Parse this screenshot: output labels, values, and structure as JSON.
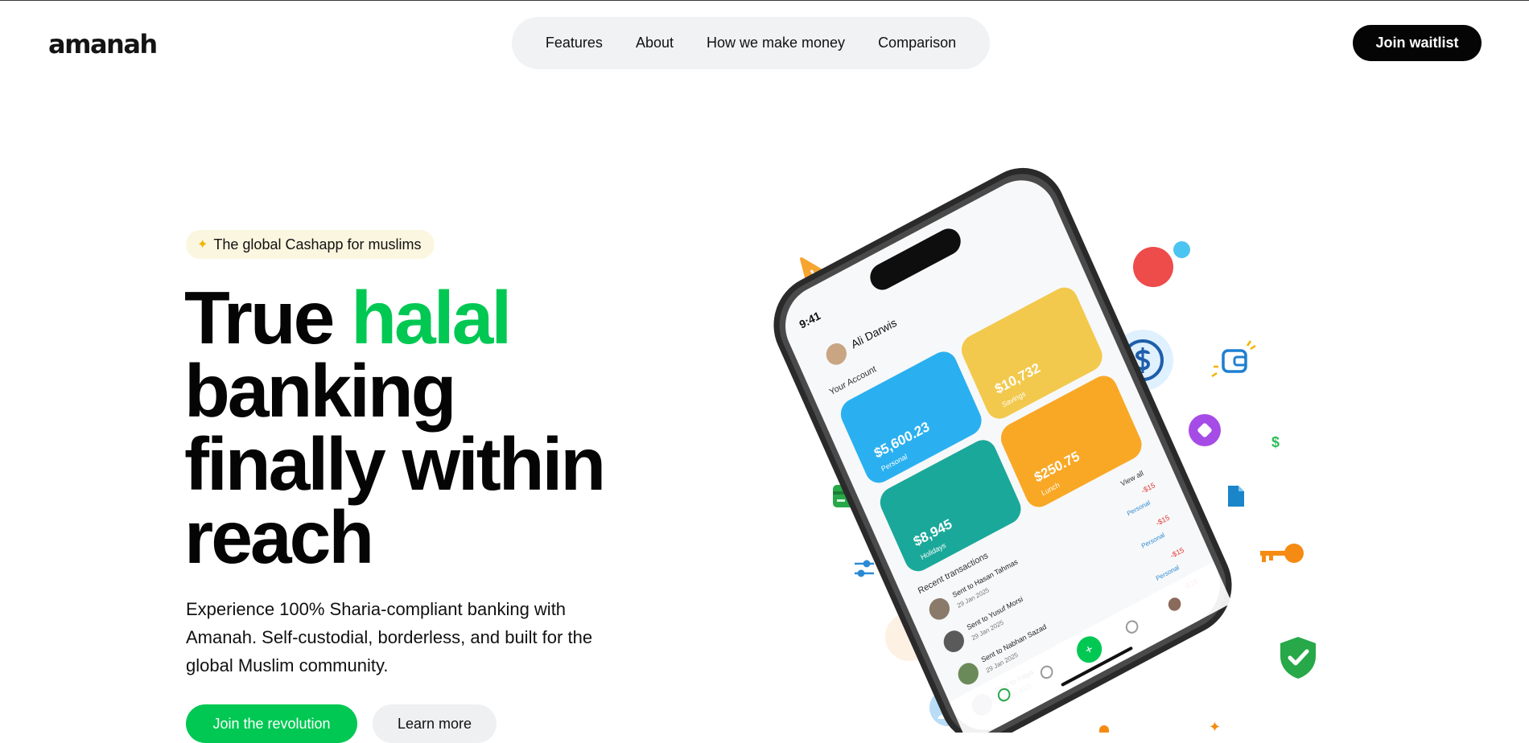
{
  "brand": {
    "logo_text": "amanah"
  },
  "nav": {
    "items": [
      {
        "label": "Features"
      },
      {
        "label": "About"
      },
      {
        "label": "How we make money"
      },
      {
        "label": "Comparison"
      }
    ]
  },
  "header": {
    "cta_label": "Join waitlist"
  },
  "hero": {
    "badge_text": "The global Cashapp for muslims",
    "badge_icon": "sparkle-icon",
    "title_part1": "True ",
    "title_highlight": "halal",
    "title_line2": "banking",
    "title_line3": "finally within",
    "title_line4": "reach",
    "description": "Experience 100% Sharia-compliant banking with Amanah. Self-custodial, borderless, and built for the global Muslim community.",
    "primary_cta": "Join the revolution",
    "secondary_cta": "Learn more"
  },
  "phone": {
    "time": "9:41",
    "user_name": "Ali Darwis",
    "section_title": "Your Account",
    "cards": [
      {
        "amount": "$5,600.23",
        "label": "Personal",
        "color": "#2ab0f0"
      },
      {
        "amount": "$10,732",
        "label": "Savings",
        "color": "#f2c94c"
      },
      {
        "amount": "$8,945",
        "label": "Holidays",
        "color": "#1aa89a"
      },
      {
        "amount": "$250.75",
        "label": "Lunch",
        "color": "#f9a825"
      }
    ],
    "recent_title": "Recent transactions",
    "view_all": "View all",
    "transactions": [
      {
        "name": "Sent to Hasan Tahmas",
        "date": "29 Jan 2025",
        "amount": "-$15",
        "tag": "Personal"
      },
      {
        "name": "Sent to Yusuf Morsi",
        "date": "29 Jan 2025",
        "amount": "-$15",
        "tag": "Personal"
      },
      {
        "name": "Sent to Nabhan Sazad",
        "date": "29 Jan 2025",
        "amount": "-$15",
        "tag": "Personal"
      },
      {
        "name": "Sent to Inaya",
        "date": "29 Jan 2025",
        "amount": "-$15",
        "tag": ""
      }
    ]
  },
  "colors": {
    "accent": "#00c853",
    "dark": "#050505",
    "nav_bg": "#f1f2f4",
    "badge_bg": "#fbf6df"
  }
}
